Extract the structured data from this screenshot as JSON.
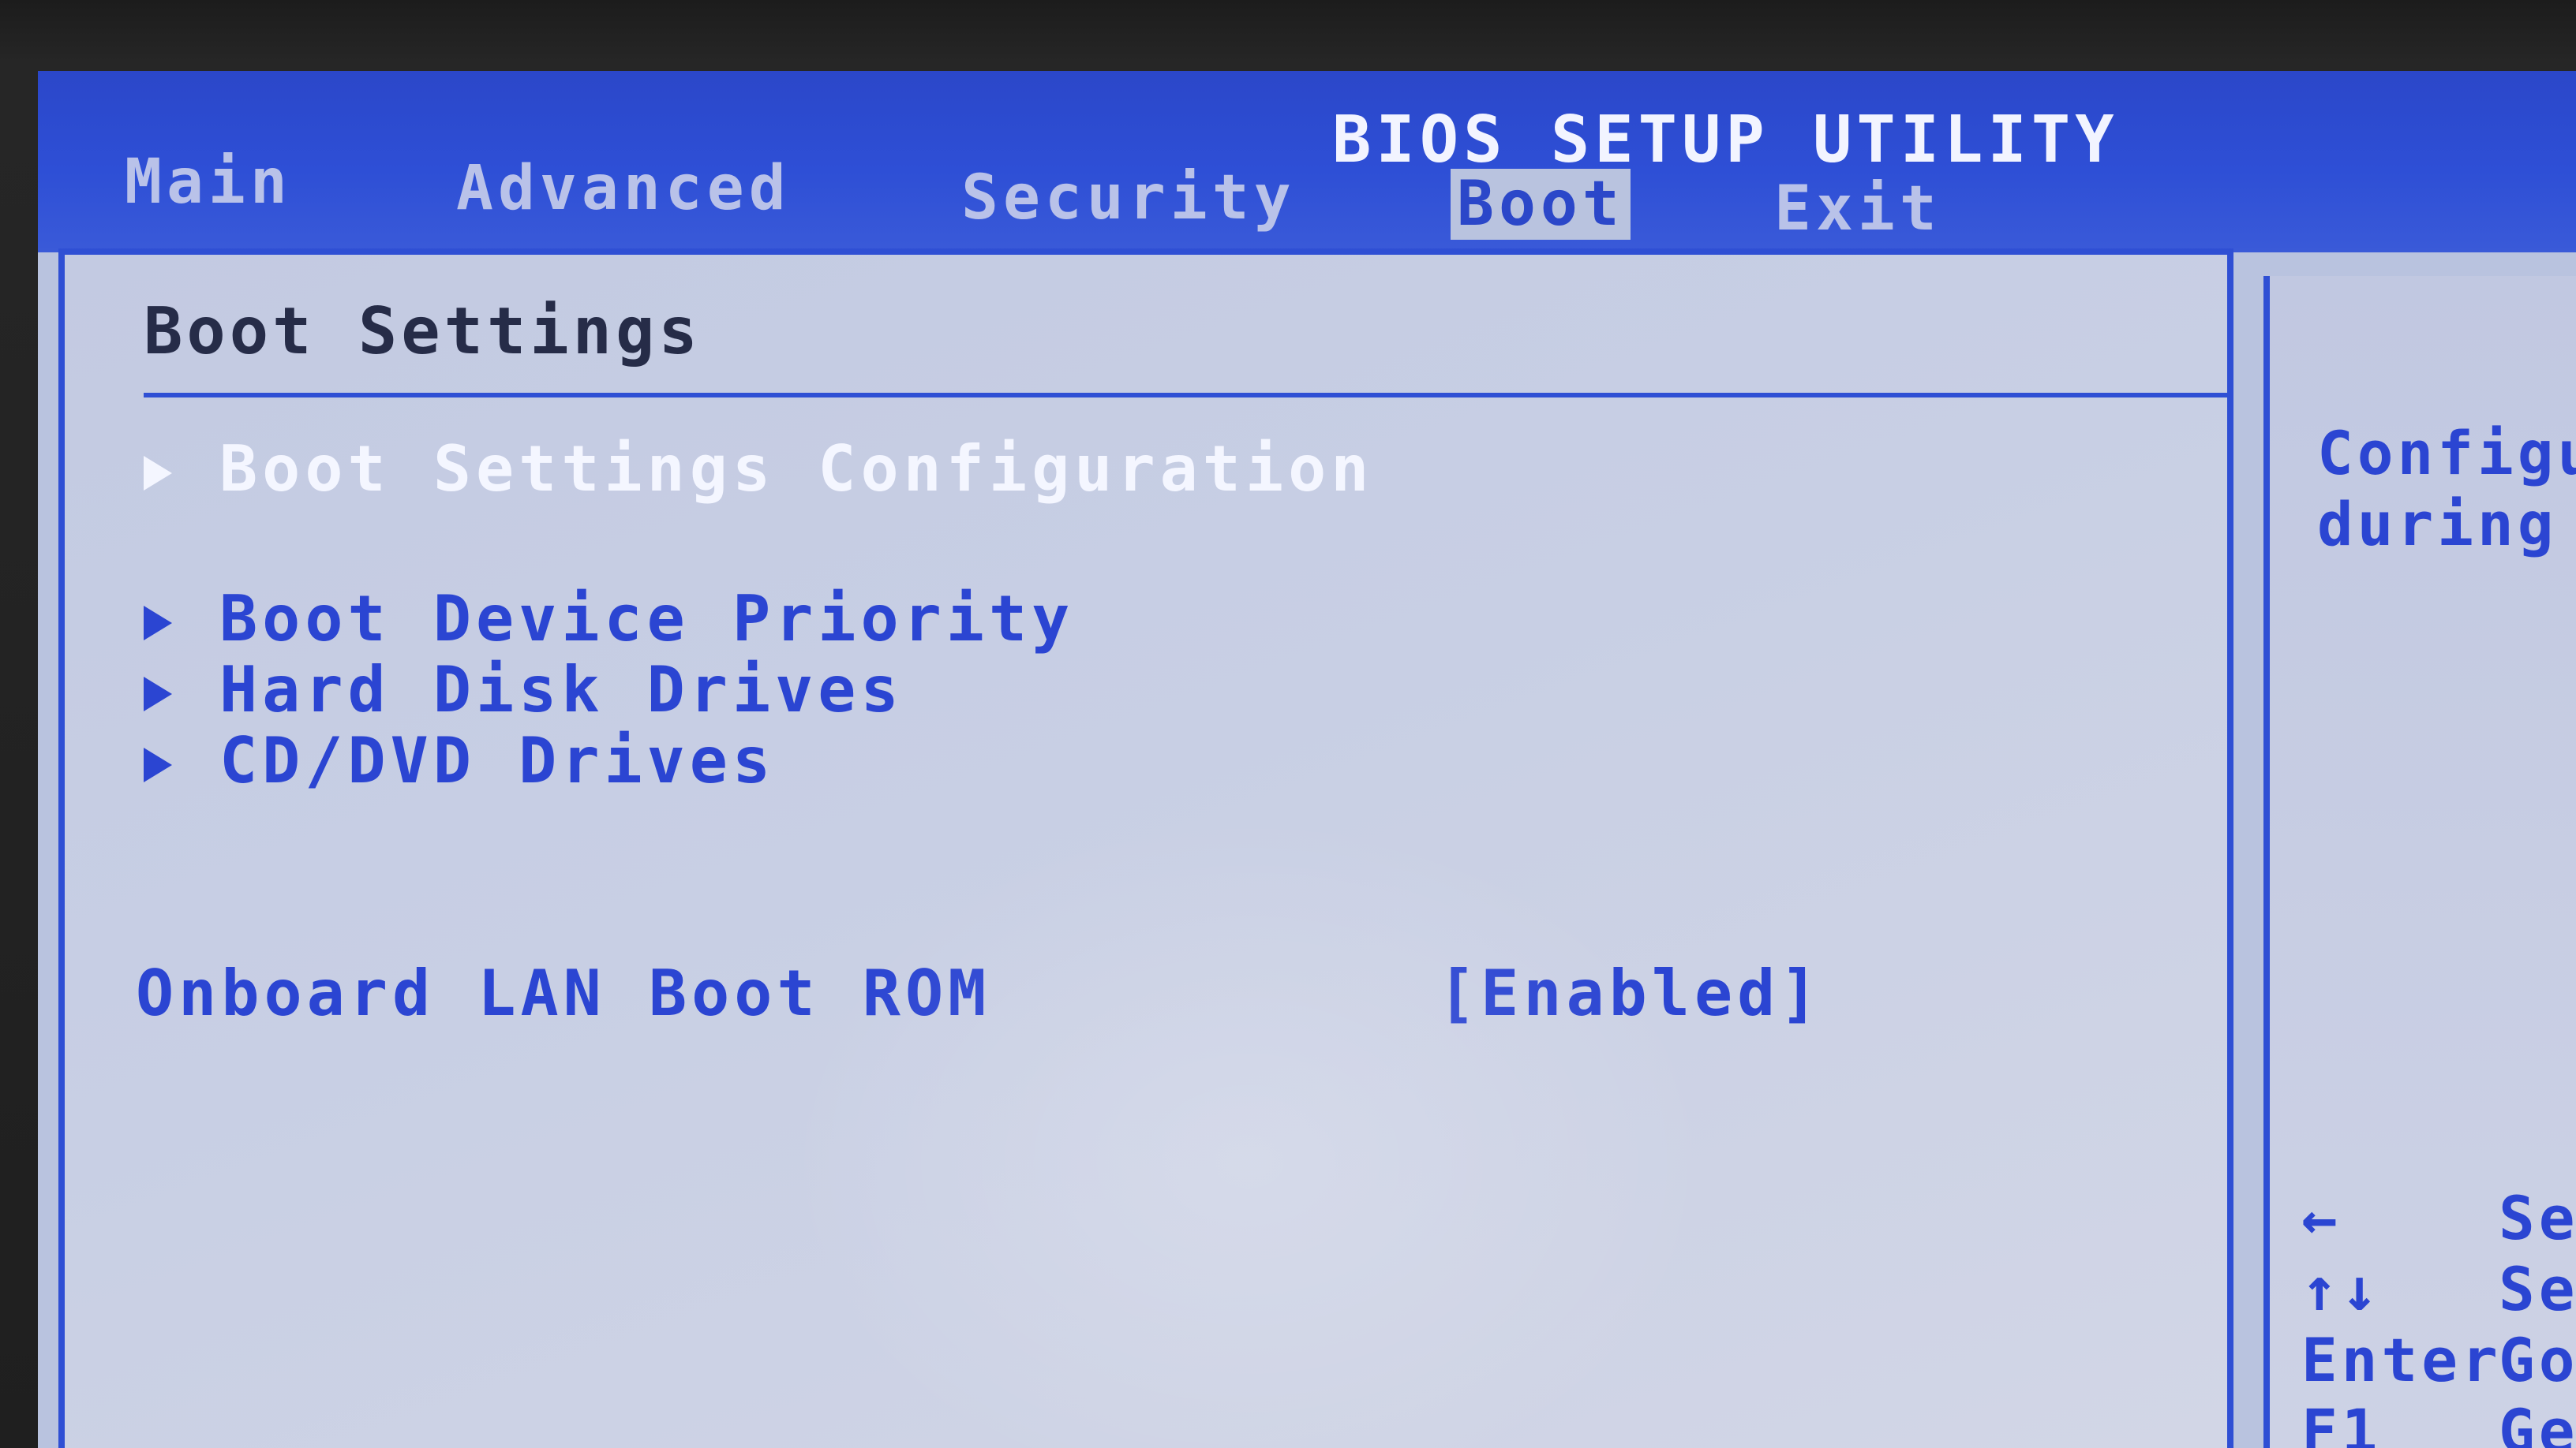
{
  "header": {
    "title": "BIOS SETUP UTILITY",
    "tabs": [
      {
        "label": "Main"
      },
      {
        "label": "Advanced"
      },
      {
        "label": "Security"
      },
      {
        "label": "Boot",
        "active": true
      },
      {
        "label": "Exit"
      }
    ]
  },
  "main": {
    "section_title": "Boot Settings",
    "menu_items": [
      {
        "label": "Boot Settings Configuration",
        "highlighted": true
      },
      {
        "label": "Boot Device Priority"
      },
      {
        "label": "Hard Disk Drives"
      },
      {
        "label": "CD/DVD Drives"
      }
    ],
    "setting": {
      "label": "Onboard LAN Boot ROM",
      "value": "[Enabled]"
    }
  },
  "help": {
    "lines": [
      "Configu",
      "during"
    ],
    "keys": [
      {
        "key": "←",
        "desc": "Sel"
      },
      {
        "key": "↑↓",
        "desc": "Se"
      },
      {
        "key": "Enter",
        "desc": "Go"
      },
      {
        "key": "F1",
        "desc": "Ge"
      }
    ]
  },
  "colors": {
    "header_blue": "#2b47c9",
    "panel_bg": "#c3cae2",
    "text_blue": "#2b45d2",
    "highlight_text": "#f4f6ff",
    "title_dark": "#262c48"
  }
}
